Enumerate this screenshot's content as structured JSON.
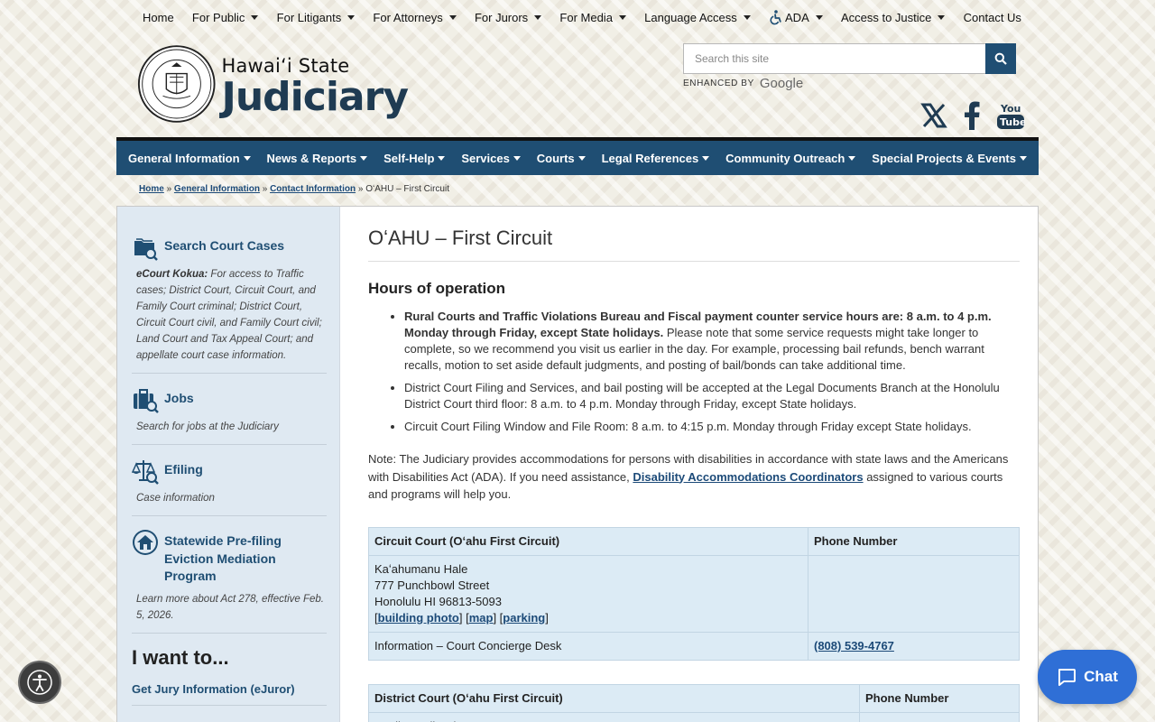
{
  "topnav": {
    "items": [
      "Home",
      "For Public",
      "For Litigants",
      "For Attorneys",
      "For Jurors",
      "For Media",
      "Language Access",
      "ADA",
      "Access to Justice",
      "Contact Us"
    ]
  },
  "logo": {
    "state": "Hawaiʻi State",
    "name": "Judiciary"
  },
  "search": {
    "placeholder": "Search this site",
    "enhanced": "ENHANCED BY",
    "google": "Google"
  },
  "mainnav": {
    "items": [
      "General Information",
      "News & Reports",
      "Self-Help",
      "Services",
      "Courts",
      "Legal References",
      "Community Outreach",
      "Special Projects & Events"
    ]
  },
  "breadcrumb": {
    "home": "Home",
    "general": "General Information",
    "contact": "Contact Information",
    "current": "OʻAHU – First Circuit",
    "sep": "»"
  },
  "sidebar": {
    "items": [
      {
        "title": "Search Court Cases",
        "desc_lead": "eCourt Kokua:",
        "desc": " For access to Traffic cases; District Court, Circuit Court, and Family Court criminal; District Court, Circuit Court civil, and Family Court civil; Land Court and Tax Appeal Court; and appellate court case information."
      },
      {
        "title": "Jobs",
        "desc": "Search for jobs at the Judiciary"
      },
      {
        "title": "Efiling",
        "desc": "Case information"
      },
      {
        "title": "Statewide Pre-filing Eviction Mediation Program",
        "desc": "Learn more about Act 278, effective Feb. 5, 2026."
      }
    ],
    "iwant": "I want to...",
    "iwant_links": [
      "Get Jury Information (eJuror)"
    ]
  },
  "content": {
    "title": "OʻAHU – First Circuit",
    "hours_heading": "Hours of operation",
    "bullets": {
      "b1_bold": "Rural Courts and Traffic Violations Bureau and Fiscal payment counter service hours are:  8 a.m. to 4 p.m. Monday through Friday, except State holidays.",
      "b1_rest": " Please note that some service requests might take longer to complete, so we recommend you visit us earlier in the day. For example, processing bail refunds, bench warrant recalls, motion to set aside default judgments, and posting of bail/bonds can take additional time.",
      "b2": "District Court Filing and Services, and bail posting will be accepted at the Legal Documents Branch at the Honolulu District Court third floor:  8 a.m. to 4 p.m. Monday through Friday, except State holidays.",
      "b3": "Circuit Court Filing Window and File Room: 8 a.m. to 4:15 p.m. Monday through Friday except State holidays."
    },
    "note_start": "Note: The Judiciary provides accommodations for persons with disabilities in accordance with state laws and the Americans with Disabilities Act (ADA). If you need assistance, ",
    "note_link": "Disability Accommodations Coordinators",
    "note_end": " assigned to various courts and programs will help you.",
    "table1": {
      "col1": "Circuit Court (Oʻahu First Circuit)",
      "col2": "Phone Number",
      "addr_name": "Kaʻahumanu Hale",
      "addr_street": "777 Punchbowl Street",
      "addr_city": "Honolulu HI 96813-5093",
      "link_photo": "building photo",
      "link_map": "map",
      "link_parking": "parking",
      "row2_label": "Information – Court Concierge Desk",
      "row2_phone": "(808) 539-4767"
    },
    "table2": {
      "col1": "District Court (Oʻahu First Circuit)",
      "col2": "Phone Number",
      "addr_name": "Kauikeaouli Hale"
    }
  },
  "chat": {
    "label": "Chat"
  },
  "colors": {
    "brand": "#1f4e73",
    "sidebar": "#dfe9f2",
    "table": "#dcebf5",
    "chat": "#2f6fd6"
  }
}
